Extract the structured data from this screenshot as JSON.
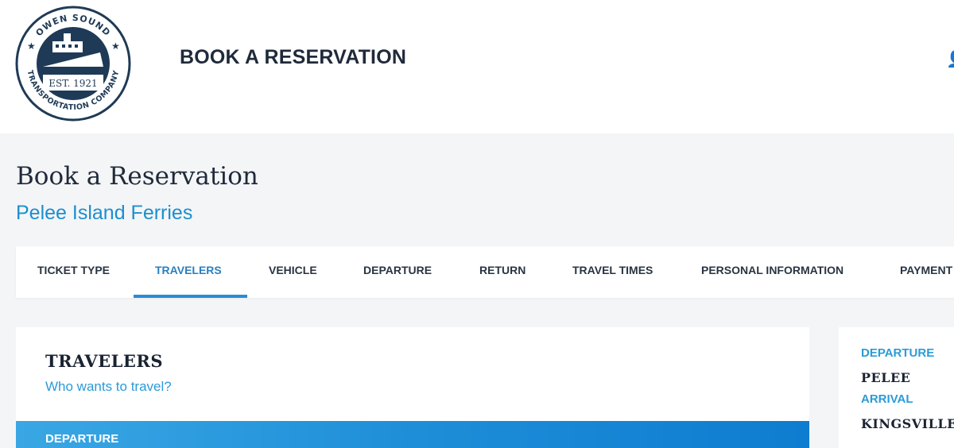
{
  "header": {
    "title": "BOOK A RESERVATION",
    "account_icon": "user-icon",
    "logo": {
      "top_text": "OWEN SOUND",
      "bottom_text": "TRANSPORTATION COMPANY",
      "est": "EST. 1921"
    }
  },
  "page": {
    "title": "Book a Reservation",
    "subtitle": "Pelee Island Ferries"
  },
  "tabs": [
    {
      "label": "TICKET TYPE"
    },
    {
      "label": "TRAVELERS",
      "active": true
    },
    {
      "label": "VEHICLE"
    },
    {
      "label": "DEPARTURE"
    },
    {
      "label": "RETURN"
    },
    {
      "label": "TRAVEL TIMES"
    },
    {
      "label": "PERSONAL INFORMATION"
    },
    {
      "label": "PAYMENT"
    }
  ],
  "travelers": {
    "title": "TRAVELERS",
    "subtitle": "Who wants to travel?",
    "band_label": "DEPARTURE"
  },
  "summary": {
    "departure_label": "DEPARTURE",
    "departure_value": "PELEE",
    "arrival_label": "ARRIVAL",
    "arrival_value": "KINGSVILLE"
  },
  "colors": {
    "accent": "#2a8bd6",
    "brand_navy": "#1f3a56",
    "link_blue": "#1c8fcf"
  }
}
